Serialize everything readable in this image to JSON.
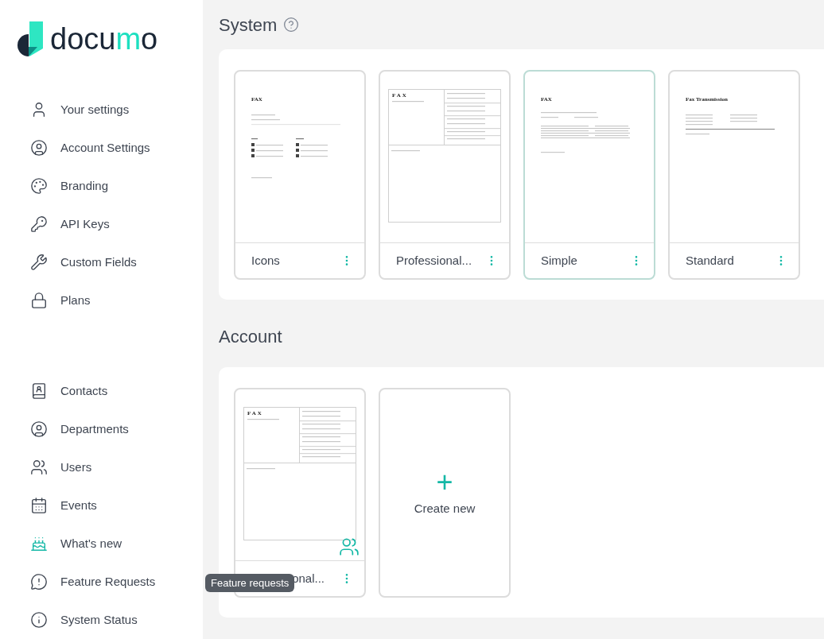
{
  "logo": {
    "parts": [
      {
        "text": "docu",
        "accent": false
      },
      {
        "text": "m",
        "accent": true
      },
      {
        "text": "o",
        "accent": false
      }
    ]
  },
  "sidebar": {
    "groups": [
      {
        "items": [
          {
            "label": "Your settings",
            "kind": "user",
            "highlighted": false
          },
          {
            "label": "Account Settings",
            "kind": "account",
            "highlighted": false
          },
          {
            "label": "Branding",
            "kind": "palette",
            "highlighted": false
          },
          {
            "label": "API Keys",
            "kind": "key",
            "highlighted": false
          },
          {
            "label": "Custom Fields",
            "kind": "tools",
            "highlighted": false
          },
          {
            "label": "Plans",
            "kind": "lock",
            "highlighted": false
          }
        ]
      },
      {
        "items": [
          {
            "label": "Contacts",
            "kind": "contacts",
            "highlighted": false
          },
          {
            "label": "Departments",
            "kind": "account",
            "highlighted": false
          },
          {
            "label": "Users",
            "kind": "users",
            "highlighted": false
          },
          {
            "label": "Events",
            "kind": "calendar",
            "highlighted": false
          },
          {
            "label": "What's new",
            "kind": "cake",
            "highlighted": true
          },
          {
            "label": "Feature Requests",
            "kind": "message",
            "highlighted": false
          },
          {
            "label": "System Status",
            "kind": "info",
            "highlighted": false
          }
        ]
      }
    ]
  },
  "tooltip": {
    "text": "Feature requests"
  },
  "sections": [
    {
      "title": "System",
      "help": true,
      "templates": [
        {
          "name": "Icons",
          "kind": "icons",
          "heading": "FAX",
          "selected": false,
          "shared": false
        },
        {
          "name": "Professional...",
          "kind": "professional",
          "heading": "FAX",
          "selected": false,
          "shared": false
        },
        {
          "name": "Simple",
          "kind": "simple",
          "heading": "FAX",
          "selected": true,
          "shared": false
        },
        {
          "name": "Standard",
          "kind": "standard",
          "heading": "Fax Transmission",
          "selected": false,
          "shared": false
        }
      ]
    },
    {
      "title": "Account",
      "help": false,
      "templates": [
        {
          "name": "onal...",
          "kind": "professional",
          "heading": "FAX",
          "selected": false,
          "shared": true,
          "covered": true
        }
      ],
      "create": {
        "label": "Create new",
        "symbol": "+"
      }
    }
  ]
}
